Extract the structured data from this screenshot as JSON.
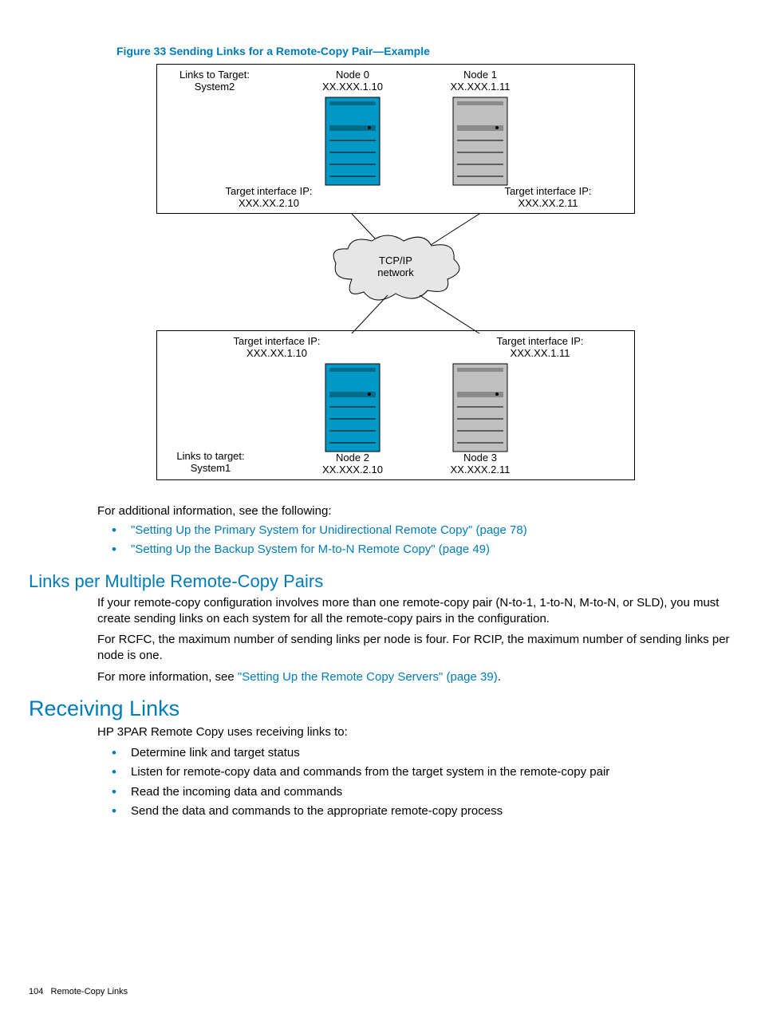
{
  "figure": {
    "caption": "Figure 33 Sending Links for a Remote-Copy Pair—Example",
    "topBox": {
      "linksLabel": "Links to Target:\nSystem2",
      "node0": {
        "name": "Node 0",
        "ip": "XX.XXX.1.10"
      },
      "node1": {
        "name": "Node 1",
        "ip": "XX.XXX.1.11"
      },
      "tif0": "Target interface IP:\nXXX.XX.2.10",
      "tif1": "Target interface IP:\nXXX.XX.2.11"
    },
    "cloud": "TCP/IP\nnetwork",
    "botBox": {
      "tif2": "Target interface IP:\nXXX.XX.1.10",
      "tif3": "Target interface IP:\nXXX.XX.1.11",
      "node2": {
        "name": "Node 2",
        "ip": "XX.XXX.2.10"
      },
      "node3": {
        "name": "Node 3",
        "ip": "XX.XXX.2.11"
      },
      "linksLabel": "Links to target:\nSystem1"
    }
  },
  "afterFig": {
    "intro": "For additional information, see the following:",
    "bullets": [
      "\"Setting Up the Primary System for Unidirectional Remote Copy\" (page 78)",
      "\"Setting Up the Backup System for M-to-N Remote Copy\" (page 49)"
    ]
  },
  "sec1": {
    "title": "Links per Multiple Remote-Copy Pairs",
    "p1": "If your remote-copy configuration involves more than one remote-copy pair (N-to-1, 1-to-N, M-to-N, or SLD), you must create sending links on each system for all the remote-copy pairs in the configuration.",
    "p2": "For RCFC, the maximum number of sending links per node is four. For RCIP, the maximum number of sending links per node is one.",
    "p3a": "For more information, see ",
    "p3link": "\"Setting Up the Remote Copy Servers\" (page 39)",
    "p3b": "."
  },
  "sec2": {
    "title": "Receiving Links",
    "intro": "HP 3PAR Remote Copy uses receiving links to:",
    "bullets": [
      "Determine link and target status",
      "Listen for remote-copy data and commands from the target system in the remote-copy pair",
      "Read the incoming data and commands",
      "Send the data and commands to the appropriate remote-copy process"
    ]
  },
  "footer": {
    "page": "104",
    "section": "Remote-Copy Links"
  }
}
